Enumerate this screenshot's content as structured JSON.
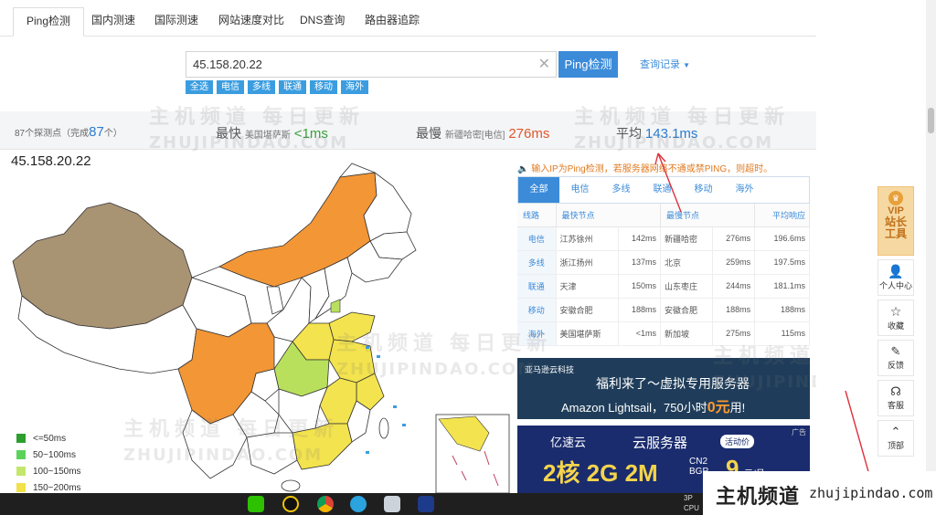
{
  "tabs": [
    {
      "label": "Ping检测",
      "active": true
    },
    {
      "label": "国内测速"
    },
    {
      "label": "国际测速"
    },
    {
      "label": "网站速度对比"
    },
    {
      "label": "DNS查询"
    },
    {
      "label": "路由器追踪"
    }
  ],
  "search": {
    "value": "45.158.20.22",
    "button": "Ping检测",
    "history": "查询记录"
  },
  "filters": [
    "全选",
    "电信",
    "多线",
    "联通",
    "移动",
    "海外"
  ],
  "stats": {
    "count_prefix": "87个探测点（完成",
    "count_done": "87",
    "count_suffix": "个）",
    "fastest_label": "最快",
    "fastest_node": "美国堪萨斯",
    "fastest_value": "<1ms",
    "slowest_label": "最慢",
    "slowest_node": "新疆哈密[电信]",
    "slowest_value": "276ms",
    "avg_label": "平均",
    "avg_value": "143.1ms"
  },
  "ip_title": "45.158.20.22",
  "notice": "输入IP为Ping检测，若服务器网络不通或禁PING，则超时。",
  "table": {
    "tabs": [
      "全部",
      "电信",
      "多线",
      "联通",
      "移动",
      "海外"
    ],
    "headers": [
      "线路",
      "最快节点",
      "",
      "最慢节点",
      "",
      "平均响应"
    ],
    "rows": [
      {
        "type": "电信",
        "fast_node": "江苏徐州",
        "fast_ms": "142ms",
        "slow_node": "新疆哈密",
        "slow_ms": "276ms",
        "avg": "196.6ms"
      },
      {
        "type": "多线",
        "fast_node": "浙江扬州",
        "fast_ms": "137ms",
        "slow_node": "北京",
        "slow_ms": "259ms",
        "avg": "197.5ms"
      },
      {
        "type": "联通",
        "fast_node": "天津",
        "fast_ms": "150ms",
        "slow_node": "山东枣庄",
        "slow_ms": "244ms",
        "avg": "181.1ms"
      },
      {
        "type": "移动",
        "fast_node": "安徽合肥",
        "fast_ms": "188ms",
        "slow_node": "安徽合肥",
        "slow_ms": "188ms",
        "avg": "188ms"
      },
      {
        "type": "海外",
        "fast_node": "美国堪萨斯",
        "fast_ms": "<1ms",
        "slow_node": "新加坡",
        "slow_ms": "275ms",
        "avg": "115ms"
      }
    ]
  },
  "legend": [
    {
      "label": "<=50ms",
      "color": "#2e9e2e"
    },
    {
      "label": "50~100ms",
      "color": "#5bd35b"
    },
    {
      "label": "100~150ms",
      "color": "#c3e66b"
    },
    {
      "label": "150~200ms",
      "color": "#f2e14a"
    }
  ],
  "map_colors": {
    "orange": "#f29636",
    "brown": "#a89373",
    "yellow": "#f3e34e",
    "lightgreen": "#b9e05c",
    "white": "#ffffff"
  },
  "ad1": {
    "brand": "亚马逊云科技",
    "line1": "福利来了～虚拟专用服务器",
    "line2_a": "Amazon Lightsail，750小时",
    "line2_b": "0元",
    "line2_c": "用!"
  },
  "ad2": {
    "brand": "亿速云",
    "title": "云服务器",
    "badge": "活动价",
    "spec": "2核 2G 2M",
    "spec2": "CN2 BGP",
    "price": "9",
    "unit": "元/月",
    "tag": "广告"
  },
  "side_tools": {
    "vip": "VIP",
    "tools": "站长工具",
    "items": [
      "个人中心",
      "收藏",
      "反馈",
      "客服",
      "顶部"
    ]
  },
  "watermark": {
    "cn": "主机频道 每日更新",
    "en": "ZHUJIPINDAO.COM"
  },
  "brand": {
    "cn": "主机频道",
    "en": "zhujipindao.com"
  },
  "taskbar_text": {
    "a": "3P",
    "b": "CPU"
  }
}
